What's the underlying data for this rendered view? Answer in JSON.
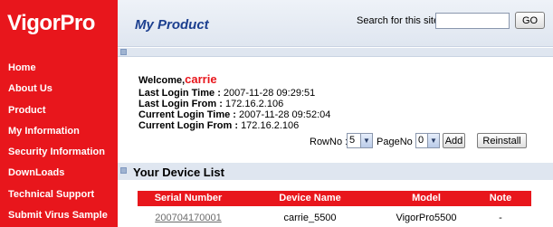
{
  "sidebar": {
    "brand": "VigorPro",
    "items": [
      {
        "label": "Home"
      },
      {
        "label": "About Us"
      },
      {
        "label": "Product"
      },
      {
        "label": "My Information"
      },
      {
        "label": "Security Information"
      },
      {
        "label": "DownLoads"
      },
      {
        "label": "Technical Support"
      },
      {
        "label": "Submit Virus Sample"
      }
    ]
  },
  "header": {
    "title": "My Product",
    "search_label": "Search for this site",
    "search_value": "",
    "go_label": "GO"
  },
  "welcome": {
    "prefix": "Welcome,",
    "user": "carrie",
    "lines": [
      {
        "label": "Last Login Time :",
        "value": "2007-11-28 09:29:51"
      },
      {
        "label": "Last Login From :",
        "value": "172.16.2.106"
      },
      {
        "label": "Current Login Time :",
        "value": "2007-11-28 09:52:04"
      },
      {
        "label": "Current Login From :",
        "value": "172.16.2.106"
      }
    ]
  },
  "controls": {
    "rowno_label": "RowNo :",
    "rowno_value": "5",
    "pageno_label": "PageNo :",
    "pageno_value": "0",
    "add_label": "Add",
    "reinstall_label": "Reinstall"
  },
  "device_list": {
    "title": "Your Device List",
    "columns": [
      "Serial Number",
      "Device Name",
      "Model",
      "Note"
    ],
    "rows": [
      {
        "serial": "200704170001",
        "device_name": "carrie_5500",
        "model": "VigorPro5500",
        "note": "-"
      }
    ]
  },
  "colors": {
    "brand_red": "#e8161c",
    "title_blue": "#1c3f8f",
    "panel_blue": "#dfe6f0"
  },
  "icons": {
    "dropdown": "chevron-down-icon",
    "bar_marker": "square-bullet-icon"
  }
}
